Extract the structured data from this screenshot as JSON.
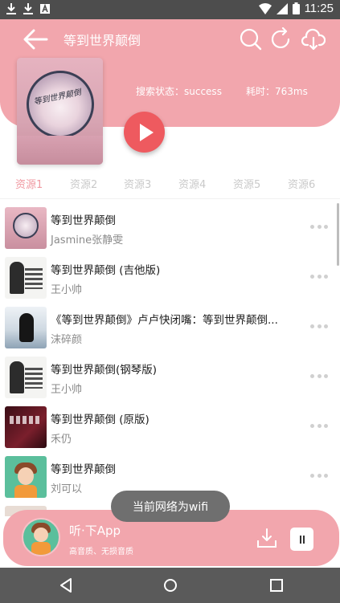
{
  "status_bar": {
    "time": "11:25",
    "left_icons": [
      "download-icon",
      "download-icon",
      "a-icon"
    ],
    "right_icons": [
      "wifi-icon",
      "signal-icon",
      "battery-icon"
    ]
  },
  "header": {
    "title": "等到世界颠倒",
    "search_status": "搜索状态：success",
    "elapsed": "耗时：763ms",
    "cover_caption": "等到世界颠倒"
  },
  "tabs": [
    "资源1",
    "资源2",
    "资源3",
    "资源4",
    "资源5",
    "资源6"
  ],
  "songs": [
    {
      "title": "等到世界颠倒",
      "artist": "Jasmine张静雯"
    },
    {
      "title": "等到世界颠倒 (吉他版)",
      "artist": "王小帅"
    },
    {
      "title": "《等到世界颠倒》卢卢快闭嘴：等到世界颠倒...",
      "artist": "沫碎颜"
    },
    {
      "title": "等到世界颠倒(钢琴版)",
      "artist": "王小帅"
    },
    {
      "title": "等到世界颠倒 (原版)",
      "artist": "禾仍"
    },
    {
      "title": "等到世界颠倒",
      "artist": "刘可以"
    }
  ],
  "toast": "当前网络为wifi",
  "player": {
    "name": "听·下App",
    "subtitle": "高音质、无损音质"
  },
  "colors": {
    "accent_pink": "#f2a6ad",
    "play_red": "#ee5a5f",
    "tab_active": "#f09aa2"
  }
}
